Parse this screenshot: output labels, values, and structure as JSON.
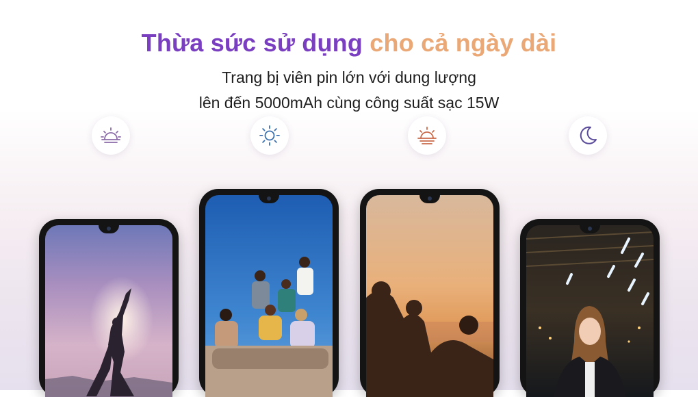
{
  "headline": {
    "part1": "Thừa sức sử dụng",
    "part2": "cho cả ngày dài"
  },
  "subtitle": {
    "line1": "Trang bị viên pin lớn với dung lượng",
    "line2": "lên đến 5000mAh cùng công suất sạc 15W"
  },
  "times_of_day": [
    {
      "icon": "sunrise-icon",
      "color": "#8a6aa8"
    },
    {
      "icon": "sun-icon",
      "color": "#3a6fb0"
    },
    {
      "icon": "sunset-icon",
      "color": "#c96a4a"
    },
    {
      "icon": "moon-icon",
      "color": "#5a4a9a"
    }
  ],
  "phones": [
    {
      "scene": "yoga-at-dawn"
    },
    {
      "scene": "friends-under-blue-sky"
    },
    {
      "scene": "friends-at-sunset"
    },
    {
      "scene": "woman-at-night"
    }
  ]
}
